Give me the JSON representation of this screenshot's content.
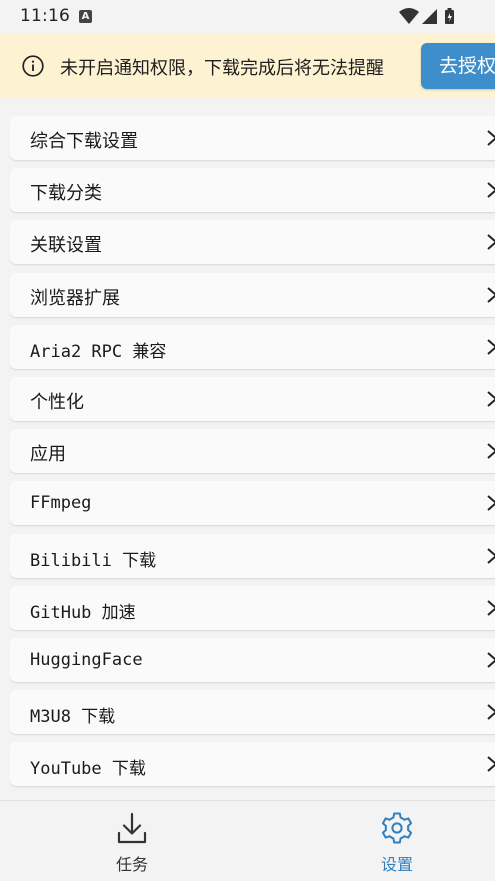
{
  "status_bar": {
    "time": "11:16",
    "notification_badge": "A"
  },
  "banner": {
    "icon": "info-icon",
    "message": "未开启通知权限，下载完成后将无法提醒",
    "button_label": "去授权"
  },
  "settings": [
    {
      "label": "综合下载设置",
      "mono": false
    },
    {
      "label": "下载分类",
      "mono": false
    },
    {
      "label": "关联设置",
      "mono": false
    },
    {
      "label": "浏览器扩展",
      "mono": false
    },
    {
      "label": "Aria2 RPC 兼容",
      "mono": true
    },
    {
      "label": "个性化",
      "mono": false
    },
    {
      "label": "应用",
      "mono": false
    },
    {
      "label": "FFmpeg",
      "mono": true
    },
    {
      "label": "Bilibili 下载",
      "mono": true
    },
    {
      "label": "GitHub 加速",
      "mono": true
    },
    {
      "label": "HuggingFace",
      "mono": true
    },
    {
      "label": "M3U8 下载",
      "mono": true
    },
    {
      "label": "YouTube 下载",
      "mono": true
    }
  ],
  "bottom_nav": {
    "tasks": {
      "label": "任务",
      "icon": "download-icon",
      "color": "#333333"
    },
    "settings": {
      "label": "设置",
      "icon": "gear-icon",
      "color": "#2f7fc1",
      "active": true
    }
  },
  "colors": {
    "accent": "#3d8ecb",
    "banner_bg": "#fdf2d2"
  }
}
